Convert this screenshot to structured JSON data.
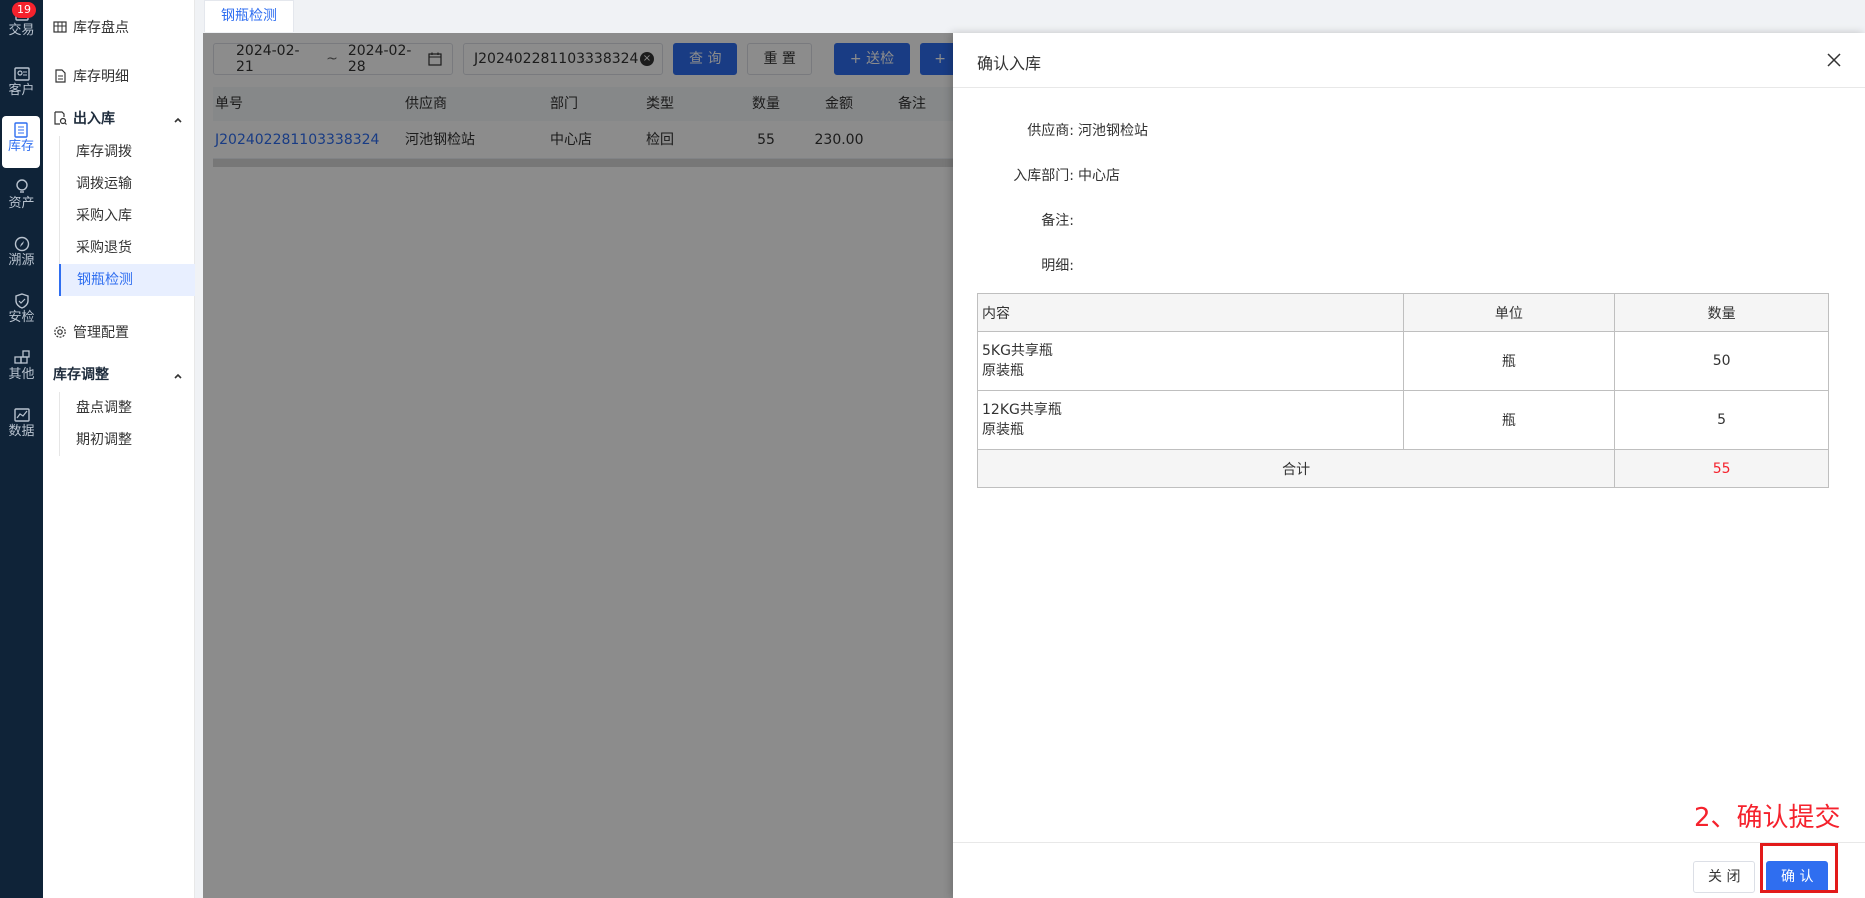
{
  "rail": {
    "badge": "19",
    "items": [
      {
        "label": "交易",
        "icon": "trade-icon"
      },
      {
        "label": "客户",
        "icon": "customer-icon"
      },
      {
        "label": "库存",
        "icon": "inventory-icon"
      },
      {
        "label": "资产",
        "icon": "asset-icon"
      },
      {
        "label": "溯源",
        "icon": "trace-icon"
      },
      {
        "label": "安检",
        "icon": "safety-icon"
      },
      {
        "label": "其他",
        "icon": "other-icon"
      },
      {
        "label": "数据",
        "icon": "data-icon"
      }
    ]
  },
  "menu": {
    "stocktake": "库存盘点",
    "stock_detail": "库存明细",
    "inout_group": "出入库",
    "inout_items": [
      "库存调拨",
      "调拨运输",
      "采购入库",
      "采购退货",
      "钢瓶检测"
    ],
    "manage_config": "管理配置",
    "adjust_group": "库存调整",
    "adjust_items": [
      "盘点调整",
      "期初调整"
    ]
  },
  "tab": "钢瓶检测",
  "filter": {
    "date_start": "2024-02-21",
    "date_sep": "~",
    "date_end": "2024-02-28",
    "search_value": "J202402281103338324",
    "query_label": "查 询",
    "reset_label": "重 置",
    "send_label": "送检",
    "plus": "+"
  },
  "grid": {
    "headers": [
      "单号",
      "供应商",
      "部门",
      "类型",
      "数量",
      "金额",
      "备注"
    ],
    "rows": [
      [
        "J202402281103338324",
        "河池钢检站",
        "中心店",
        "检回",
        "55",
        "230.00",
        ""
      ]
    ]
  },
  "drawer": {
    "title": "确认入库",
    "supplier_label": "供应商:",
    "supplier_value": "河池钢检站",
    "dept_label": "入库部门:",
    "dept_value": "中心店",
    "remark_label": "备注:",
    "detail_label": "明细:",
    "table": {
      "headers": [
        "内容",
        "单位",
        "数量"
      ],
      "rows": [
        {
          "name1": "5KG共享瓶",
          "name2": "原装瓶",
          "unit": "瓶",
          "qty": "50"
        },
        {
          "name1": "12KG共享瓶",
          "name2": "原装瓶",
          "unit": "瓶",
          "qty": "5"
        }
      ],
      "total_label": "合计",
      "total_value": "55"
    },
    "close_label": "关 闭",
    "confirm_label": "确 认"
  },
  "annotation": "2、确认提交",
  "colors": {
    "accent": "#2f6ef0",
    "annotation": "#f5222d",
    "rail_bg": "#0f2338"
  }
}
